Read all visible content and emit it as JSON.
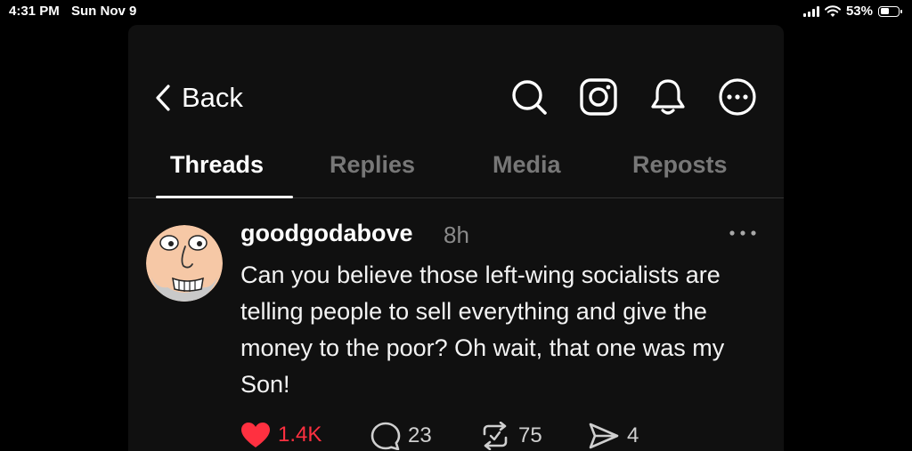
{
  "status_bar": {
    "time": "4:31 PM",
    "date": "Sun Nov 9",
    "battery": "53%",
    "battery_level": 0.53,
    "icons": [
      "signal-icon",
      "wifi-icon",
      "battery-icon"
    ]
  },
  "header": {
    "back_label": "Back",
    "icons": [
      "chevron-left-icon",
      "search-icon",
      "instagram-icon",
      "bell-icon",
      "more-circle-icon"
    ]
  },
  "tabs": [
    {
      "label": "Threads",
      "active": true
    },
    {
      "label": "Replies",
      "active": false
    },
    {
      "label": "Media",
      "active": false
    },
    {
      "label": "Reposts",
      "active": false
    }
  ],
  "post": {
    "username": "goodgodabove",
    "timestamp": "8h",
    "text": "Can you believe those left-wing socialists are telling people to sell everything and give the money to the poor? Oh wait, that one was my Son!",
    "likes": "1.4K",
    "replies": "23",
    "reposts": "75",
    "shares": "4",
    "liked": true
  },
  "colors": {
    "background": "#000000",
    "panel": "#101010",
    "like_red": "#ff3040",
    "muted_tab": "#777777",
    "avatar_bg": "#f6c8a6"
  }
}
